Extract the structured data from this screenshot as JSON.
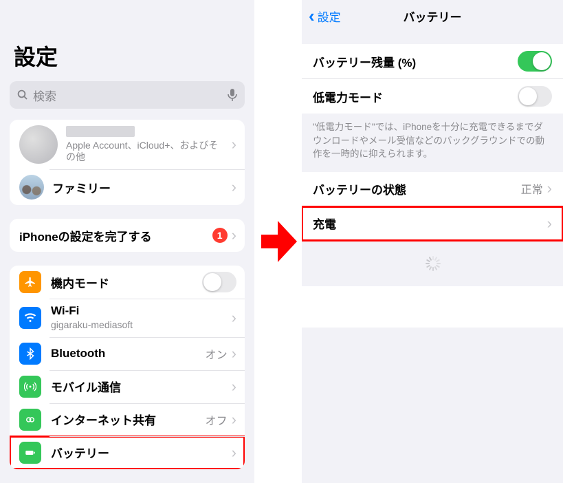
{
  "left": {
    "title": "設定",
    "search_placeholder": "検索",
    "account_sub": "Apple Account、iCloud+、およびその他",
    "family_label": "ファミリー",
    "complete_setup": "iPhoneの設定を完了する",
    "complete_badge": "1",
    "items": [
      {
        "label": "機内モード",
        "value": "",
        "type": "toggle_off",
        "icon": "airplane",
        "color": "#ff9500"
      },
      {
        "label": "Wi-Fi",
        "value": "gigaraku-mediasoft",
        "type": "detail_sub",
        "icon": "wifi",
        "color": "#007aff"
      },
      {
        "label": "Bluetooth",
        "value": "オン",
        "type": "detail",
        "icon": "bluetooth",
        "color": "#007aff"
      },
      {
        "label": "モバイル通信",
        "value": "",
        "type": "detail",
        "icon": "cellular",
        "color": "#34c759"
      },
      {
        "label": "インターネット共有",
        "value": "オフ",
        "type": "detail",
        "icon": "hotspot",
        "color": "#34c759"
      },
      {
        "label": "バッテリー",
        "value": "",
        "type": "detail",
        "icon": "battery",
        "color": "#34c759",
        "highlight": true
      }
    ]
  },
  "right": {
    "back_label": "設定",
    "title": "バッテリー",
    "rows1": [
      {
        "label": "バッテリー残量 (%)",
        "type": "toggle_on"
      },
      {
        "label": "低電力モード",
        "type": "toggle_off"
      }
    ],
    "note": "\"低電力モード\"では、iPhoneを十分に充電できるまでダウンロードやメール受信などのバックグラウンドでの動作を一時的に抑えられます。",
    "rows2": [
      {
        "label": "バッテリーの状態",
        "value": "正常",
        "type": "detail"
      },
      {
        "label": "充電",
        "value": "",
        "type": "detail",
        "highlight": true
      }
    ]
  }
}
